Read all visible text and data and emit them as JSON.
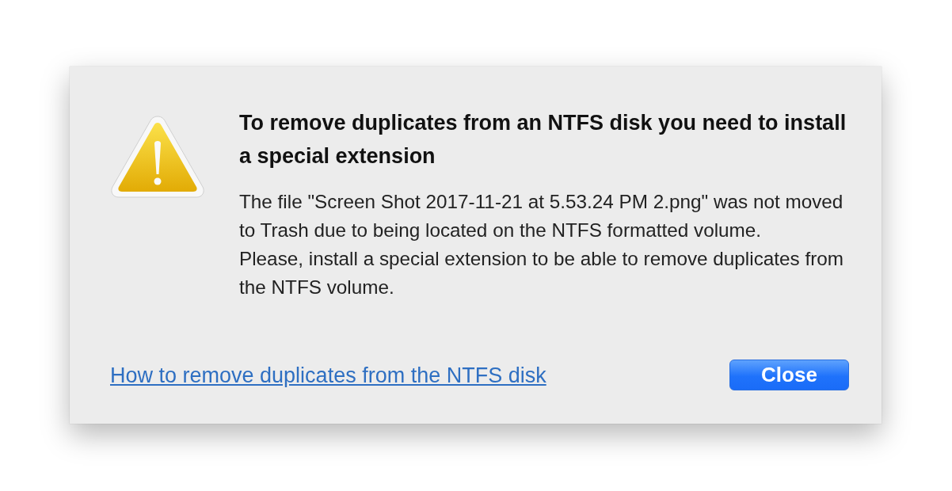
{
  "dialog": {
    "title": "To remove duplicates from an NTFS disk you need to install a special extension",
    "message": [
      "The file \"Screen Shot 2017-11-21 at 5.53.24 PM 2.png\" was not moved to Trash due to being located on the NTFS formatted volume.",
      "Please, install a special extension to be able to remove duplicates from the NTFS volume."
    ],
    "help_link": "How to remove duplicates from the NTFS disk",
    "buttons": [
      {
        "label": "Close",
        "default": true
      }
    ]
  }
}
